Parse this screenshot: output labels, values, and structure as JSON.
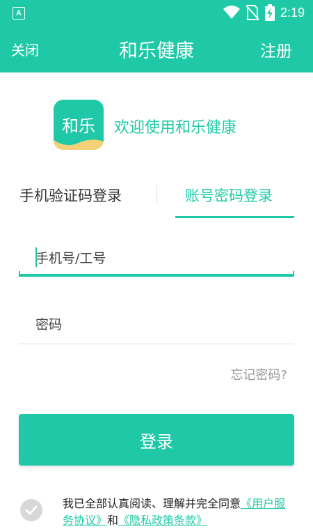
{
  "status_bar": {
    "time": "2:19",
    "notification_icon": "A"
  },
  "app_bar": {
    "close_label": "关闭",
    "title": "和乐健康",
    "register_label": "注册"
  },
  "brand": {
    "logo_text": "和乐",
    "welcome": "欢迎使用和乐健康"
  },
  "tabs": {
    "sms_login": "手机验证码登录",
    "password_login": "账号密码登录",
    "active": "password_login"
  },
  "form": {
    "account_placeholder": "手机号/工号",
    "account_value": "",
    "password_placeholder": "密码",
    "password_value": "",
    "forgot_label": "忘记密码?"
  },
  "login_button": "登录",
  "agreement": {
    "prefix": "我已全部认真阅读、理解并完全同意",
    "user_agreement": "《用户服务协议》",
    "conjunction": "和",
    "privacy_policy": "《隐私政策条款》",
    "checked": false
  },
  "colors": {
    "accent": "#1fc9a7",
    "muted_text": "#9a9a9a",
    "divider": "#dddddd"
  }
}
